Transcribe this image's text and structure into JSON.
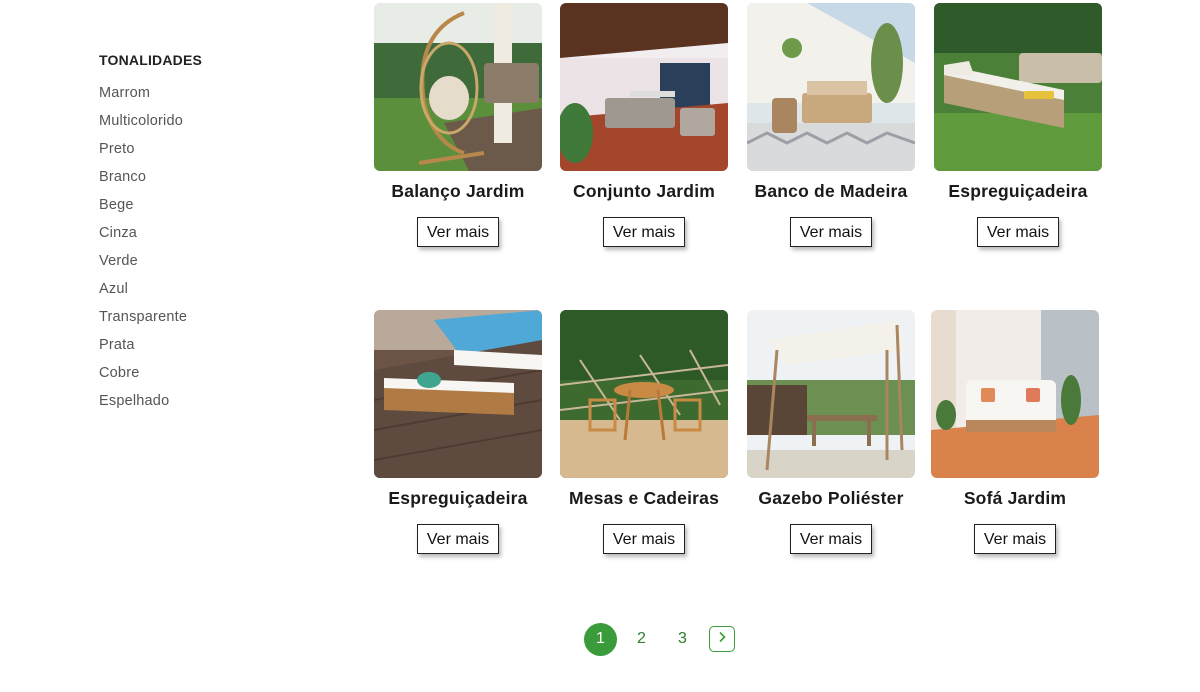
{
  "filters": {
    "heading": "TONALIDADES",
    "items": [
      "Marrom",
      "Multicolorido",
      "Preto",
      "Branco",
      "Bege",
      "Cinza",
      "Verde",
      "Azul",
      "Transparente",
      "Prata",
      "Cobre",
      "Espelhado"
    ]
  },
  "products": [
    {
      "title": "Balanço Jardim",
      "button": "Ver mais"
    },
    {
      "title": "Conjunto Jardim",
      "button": "Ver mais"
    },
    {
      "title": "Banco de Madeira",
      "button": "Ver mais"
    },
    {
      "title": "Espreguiçadeira",
      "button": "Ver mais"
    },
    {
      "title": "Espreguiçadeira",
      "button": "Ver mais"
    },
    {
      "title": "Mesas e Cadeiras",
      "button": "Ver mais"
    },
    {
      "title": "Gazebo Poliéster",
      "button": "Ver mais"
    },
    {
      "title": "Sofá Jardim",
      "button": "Ver mais"
    }
  ],
  "pagination": {
    "pages": [
      "1",
      "2",
      "3"
    ],
    "current": "1",
    "next_icon": "chevron-right-icon"
  },
  "colors": {
    "accent": "#3a9b3a"
  }
}
